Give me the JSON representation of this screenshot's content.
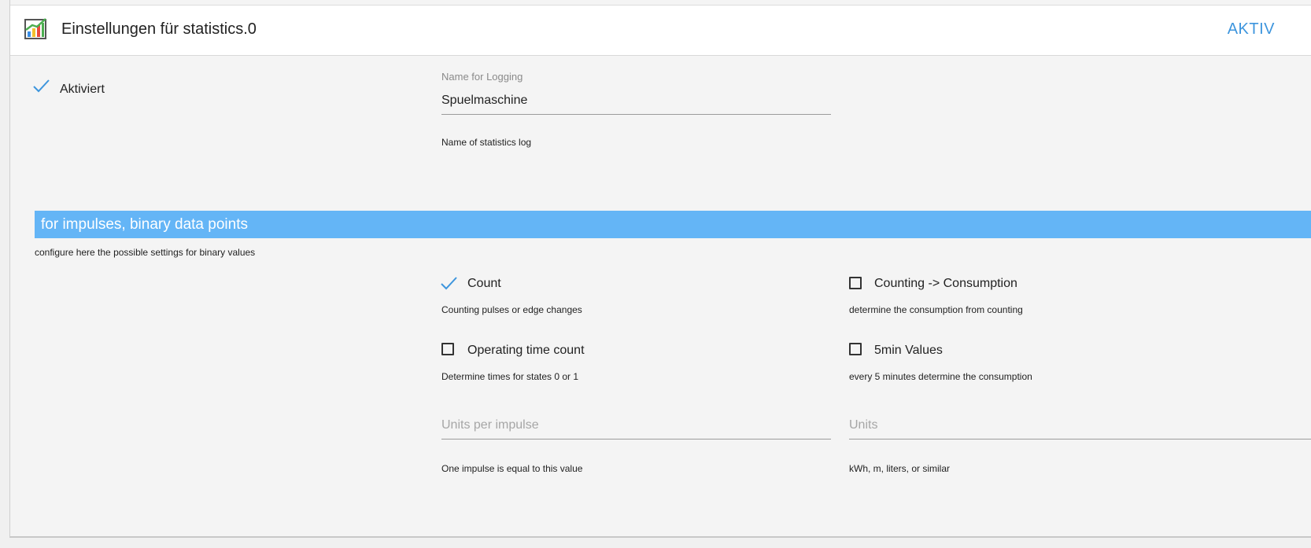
{
  "header": {
    "title": "Einstellungen für statistics.0",
    "status_label": "AKTIV"
  },
  "general": {
    "enabled_label": "Aktiviert",
    "enabled": true,
    "name_field": {
      "label": "Name for Logging",
      "value": "Spuelmaschine",
      "help": "Name of statistics log"
    }
  },
  "binary_section": {
    "title": "for impulses, binary data points",
    "description": "configure here the possible settings for binary values",
    "options": [
      {
        "label": "Count",
        "checked": true,
        "help": "Counting pulses or edge changes"
      },
      {
        "label": "Counting -> Consumption",
        "checked": false,
        "help": "determine the consumption from counting"
      },
      {
        "label": "Operating time count",
        "checked": false,
        "help": "Determine times for states 0 or 1"
      },
      {
        "label": "5min Values",
        "checked": false,
        "help": "every 5 minutes determine the consumption"
      }
    ],
    "units_per_impulse": {
      "placeholder": "Units per impulse",
      "value": "",
      "help": "One impulse is equal to this value"
    },
    "units": {
      "placeholder": "Units",
      "value": "",
      "help": "kWh, m, liters, or similar"
    }
  },
  "colors": {
    "accent": "#3d95dd",
    "section_bar": "#64b5f6"
  }
}
